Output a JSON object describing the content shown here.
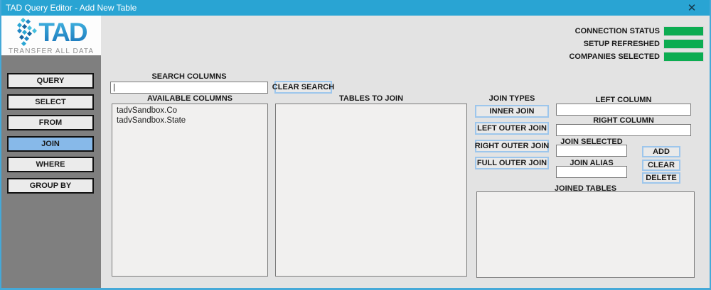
{
  "window": {
    "title": "TAD Query Editor - Add New Table",
    "close_glyph": "✕"
  },
  "logo": {
    "brand": "TAD",
    "tagline": "TRANSFER ALL DATA"
  },
  "status": {
    "items": [
      {
        "label": "CONNECTION STATUS",
        "state": "green"
      },
      {
        "label": "SETUP REFRESHED",
        "state": "green"
      },
      {
        "label": "COMPANIES SELECTED",
        "state": "green"
      }
    ],
    "ok_color": "#0cac51"
  },
  "sidebar": {
    "items": [
      {
        "label": "QUERY",
        "active": false
      },
      {
        "label": "SELECT",
        "active": false
      },
      {
        "label": "FROM",
        "active": false
      },
      {
        "label": "JOIN",
        "active": true
      },
      {
        "label": "WHERE",
        "active": false
      },
      {
        "label": "GROUP BY",
        "active": false
      }
    ]
  },
  "search": {
    "label": "SEARCH COLUMNS",
    "value": "",
    "placeholder": "",
    "clear_button": "CLEAR SEARCH"
  },
  "available_columns": {
    "label": "AVAILABLE COLUMNS",
    "items": [
      "tadvSandbox.Co",
      "tadvSandbox.State"
    ]
  },
  "tables_to_join": {
    "label": "TABLES TO JOIN",
    "items": []
  },
  "join_types": {
    "label": "JOIN TYPES",
    "buttons": [
      "INNER JOIN",
      "LEFT OUTER JOIN",
      "RIGHT OUTER JOIN",
      "FULL OUTER JOIN"
    ]
  },
  "join_fields": {
    "left_column": {
      "label": "LEFT COLUMN",
      "value": ""
    },
    "right_column": {
      "label": "RIGHT COLUMN",
      "value": ""
    },
    "join_selected": {
      "label": "JOIN SELECTED",
      "value": ""
    },
    "join_alias": {
      "label": "JOIN ALIAS",
      "value": ""
    }
  },
  "actions": {
    "add": "ADD",
    "clear": "CLEAR",
    "delete": "DELETE"
  },
  "joined_tables": {
    "label": "JOINED TABLES",
    "items": []
  },
  "colors": {
    "titlebar": "#29a4d3",
    "window_border": "#45a9d8",
    "active_nav": "#87b9e9",
    "accent_border": "#9dc6ec",
    "status_green": "#0cac51",
    "sidebar_gray": "#7f7f7f"
  }
}
